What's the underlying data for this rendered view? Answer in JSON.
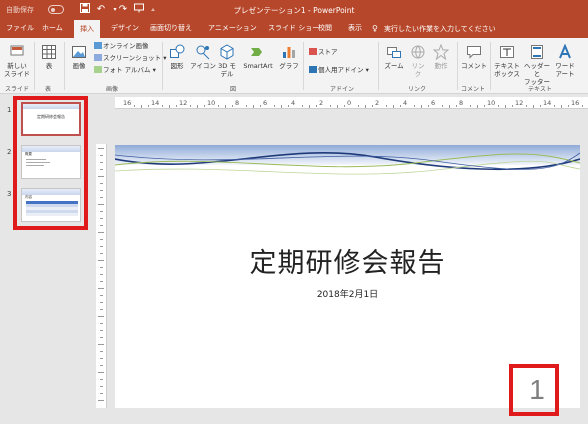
{
  "window": {
    "autosave_label": "自動保存",
    "autosave_state": "オフ",
    "title": "プレゼンテーション1 - PowerPoint"
  },
  "quick_access": {
    "icons": [
      "save-icon",
      "undo-icon",
      "redo-icon",
      "present-icon",
      "customize-icon"
    ]
  },
  "tabs": [
    {
      "label": "ファイル",
      "active": false
    },
    {
      "label": "ホーム",
      "active": false
    },
    {
      "label": "挿入",
      "active": true
    },
    {
      "label": "デザイン",
      "active": false
    },
    {
      "label": "画面切り替え",
      "active": false
    },
    {
      "label": "アニメーション",
      "active": false
    },
    {
      "label": "スライド ショー",
      "active": false
    },
    {
      "label": "校閲",
      "active": false
    },
    {
      "label": "表示",
      "active": false
    }
  ],
  "tell_me": {
    "text": "実行したい作業を入力してください"
  },
  "ribbon": {
    "slides": {
      "new_slide": "新しい",
      "new_slide_2": "スライド",
      "group": "スライド"
    },
    "tables": {
      "table": "表",
      "group": "表"
    },
    "images": {
      "picture": "画像",
      "online_pictures": "オンライン画像",
      "screenshot": "スクリーンショット",
      "photo_album": "フォト アルバム",
      "group": "画像"
    },
    "illustrations": {
      "shapes": "図形",
      "icons": "アイコン",
      "model_3d": "3D モ",
      "model_3d_2": "デル",
      "smartart": "SmartArt",
      "chart": "グラフ",
      "group": "図"
    },
    "addins": {
      "store": "ストア",
      "my_addins": "個人用アドイン",
      "group": "アドイン"
    },
    "links": {
      "zoom": "ズーム",
      "link": "リン",
      "link_2": "ク",
      "action": "動作",
      "group": "リンク"
    },
    "comments": {
      "comment": "コメント",
      "group": "コメント"
    },
    "text": {
      "textbox": "テキスト",
      "textbox_2": "ボックス",
      "header_footer": "ヘッダーと",
      "header_footer_2": "フッター",
      "wordart": "ワード",
      "wordart_2": "アート",
      "group": "テキスト"
    }
  },
  "thumbnails": [
    {
      "number": "1",
      "mini_title": "定期研修会報告"
    },
    {
      "number": "2",
      "mini_title": "概要"
    },
    {
      "number": "3",
      "mini_title": "内容"
    }
  ],
  "ruler": {
    "h_labels": [
      "16",
      "14",
      "12",
      "10",
      "8",
      "6",
      "4",
      "2",
      "0",
      "2",
      "4",
      "6",
      "8",
      "10",
      "12",
      "14",
      "16"
    ]
  },
  "slide": {
    "title": "定期研修会報告",
    "subtitle": "2018年2月1日",
    "page_number": "1"
  },
  "colors": {
    "accent": "#b7472a",
    "ribbon": "#f3f3f3",
    "highlight": "#e01a1a",
    "wave_blue": "#1f3a7a",
    "wave_green": "#9bbb59"
  }
}
